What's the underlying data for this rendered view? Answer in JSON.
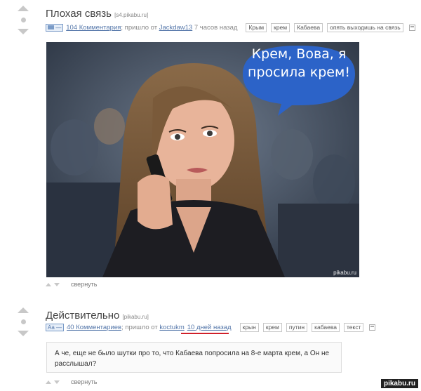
{
  "posts": [
    {
      "title": "Плохая связь",
      "domain": "[s4.pikabu.ru]",
      "badge": "—",
      "comments": "104 Комментария",
      "posted_text": "; пришло от ",
      "author": "Jackdaw13",
      "time": " 7 часов назад",
      "tags": [
        "Крым",
        "крем",
        "Кабаева",
        "опять выходишь на связь"
      ],
      "image": {
        "bubble_text": "Крем, Вова, я просила крем!",
        "watermark": "pikabu.ru"
      },
      "collapse": "свернуть"
    },
    {
      "title": "Действительно",
      "domain": "[pikabu.ru]",
      "badge": "Aa —",
      "comments": "40 Комментариев",
      "posted_text": "; пришло от ",
      "author": "koctukm",
      "time": "10 дней назад",
      "tags": [
        "крын",
        "крем",
        "путин",
        "кабаева",
        "текст"
      ],
      "text": "А че, еще не было шутки про то, что Кабаева попросила на 8-е марта крем, а Он не расслышал?",
      "collapse": "свернуть"
    }
  ],
  "site_watermark": "pikabu.ru",
  "colors": {
    "link": "#5577aa",
    "highlight_underline": "#d0202a",
    "bubble": "#2c63c8"
  }
}
